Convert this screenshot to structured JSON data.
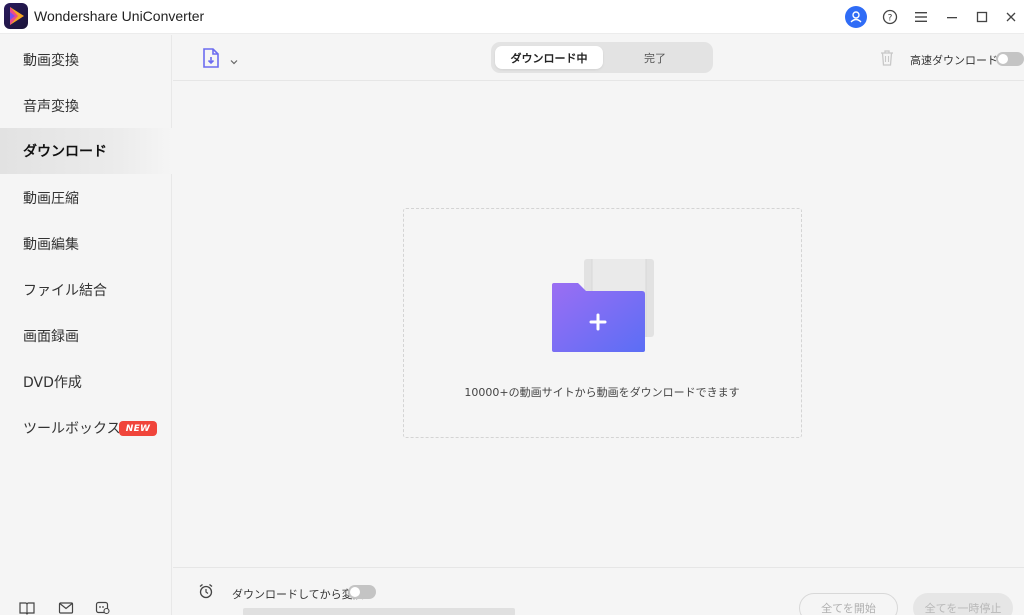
{
  "app": {
    "title": "Wondershare UniConverter"
  },
  "sidebar": {
    "items": [
      {
        "label": "動画変換"
      },
      {
        "label": "音声変換"
      },
      {
        "label": "ダウンロード"
      },
      {
        "label": "動画圧縮"
      },
      {
        "label": "動画編集"
      },
      {
        "label": "ファイル結合"
      },
      {
        "label": "画面録画"
      },
      {
        "label": "DVD作成"
      },
      {
        "label": "ツールボックス"
      }
    ],
    "active_index": 2,
    "new_badge": "NEW",
    "footer_icons": [
      "book-icon",
      "mail-icon",
      "feedback-icon"
    ]
  },
  "toolbar": {
    "add_icon": "add-url-icon",
    "tabs": [
      {
        "label": "ダウンロード中"
      },
      {
        "label": "完了"
      }
    ],
    "active_tab": 0,
    "fast_download_label": "高速ダウンロード",
    "fast_download_on": false
  },
  "main": {
    "drop_text": "10000+の動画サイトから動画をダウンロードできます",
    "drop_icon": "folder-plus-icon"
  },
  "bottom": {
    "convert_after_label": "ダウンロードしてから変換",
    "convert_after_on": false,
    "start_all_label": "全てを開始",
    "pause_all_label": "全てを一時停止"
  },
  "colors": {
    "accent": "#2f6cf6",
    "folder_gradient_start": "#9b6ef3",
    "folder_gradient_end": "#5b6ef5",
    "badge": "#f0453b"
  }
}
